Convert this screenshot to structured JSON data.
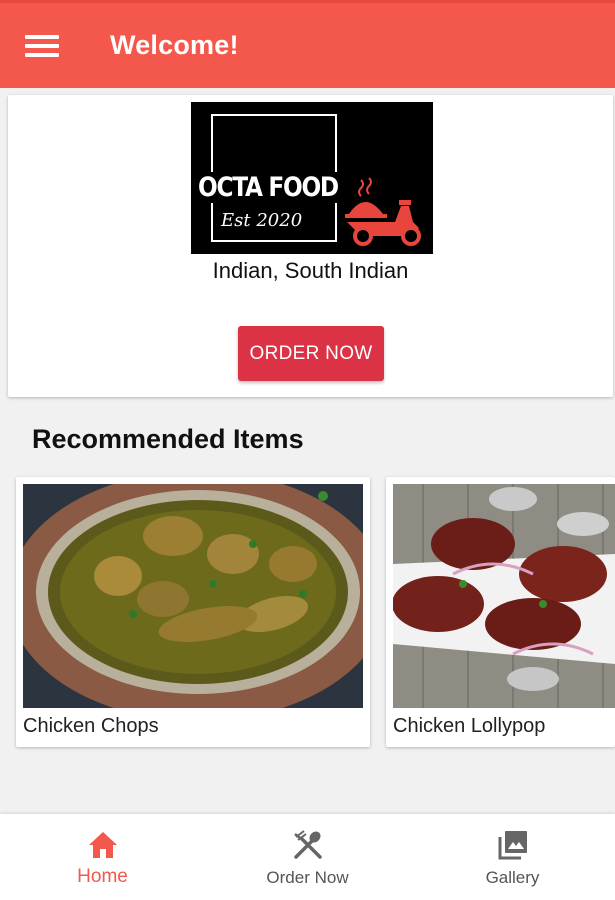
{
  "appbar": {
    "title": "Welcome!",
    "menu_icon": "hamburger-menu-icon",
    "color": "#f4574c"
  },
  "restaurant": {
    "logo_text": "OCTA FOOD",
    "logo_subtext": "Est 2020",
    "cuisine": "Indian, South Indian",
    "order_button": "ORDER NOW",
    "order_button_color": "#dc3246"
  },
  "recommended": {
    "title": "Recommended Items",
    "items": [
      {
        "name": "Chicken Chops"
      },
      {
        "name": "Chicken Lollypop"
      }
    ]
  },
  "bottom_nav": {
    "items": [
      {
        "label": "Home",
        "icon": "home-icon",
        "active": true
      },
      {
        "label": "Order Now",
        "icon": "fork-spoon-icon",
        "active": false
      },
      {
        "label": "Gallery",
        "icon": "gallery-icon",
        "active": false
      }
    ],
    "active_color": "#f4574c"
  }
}
